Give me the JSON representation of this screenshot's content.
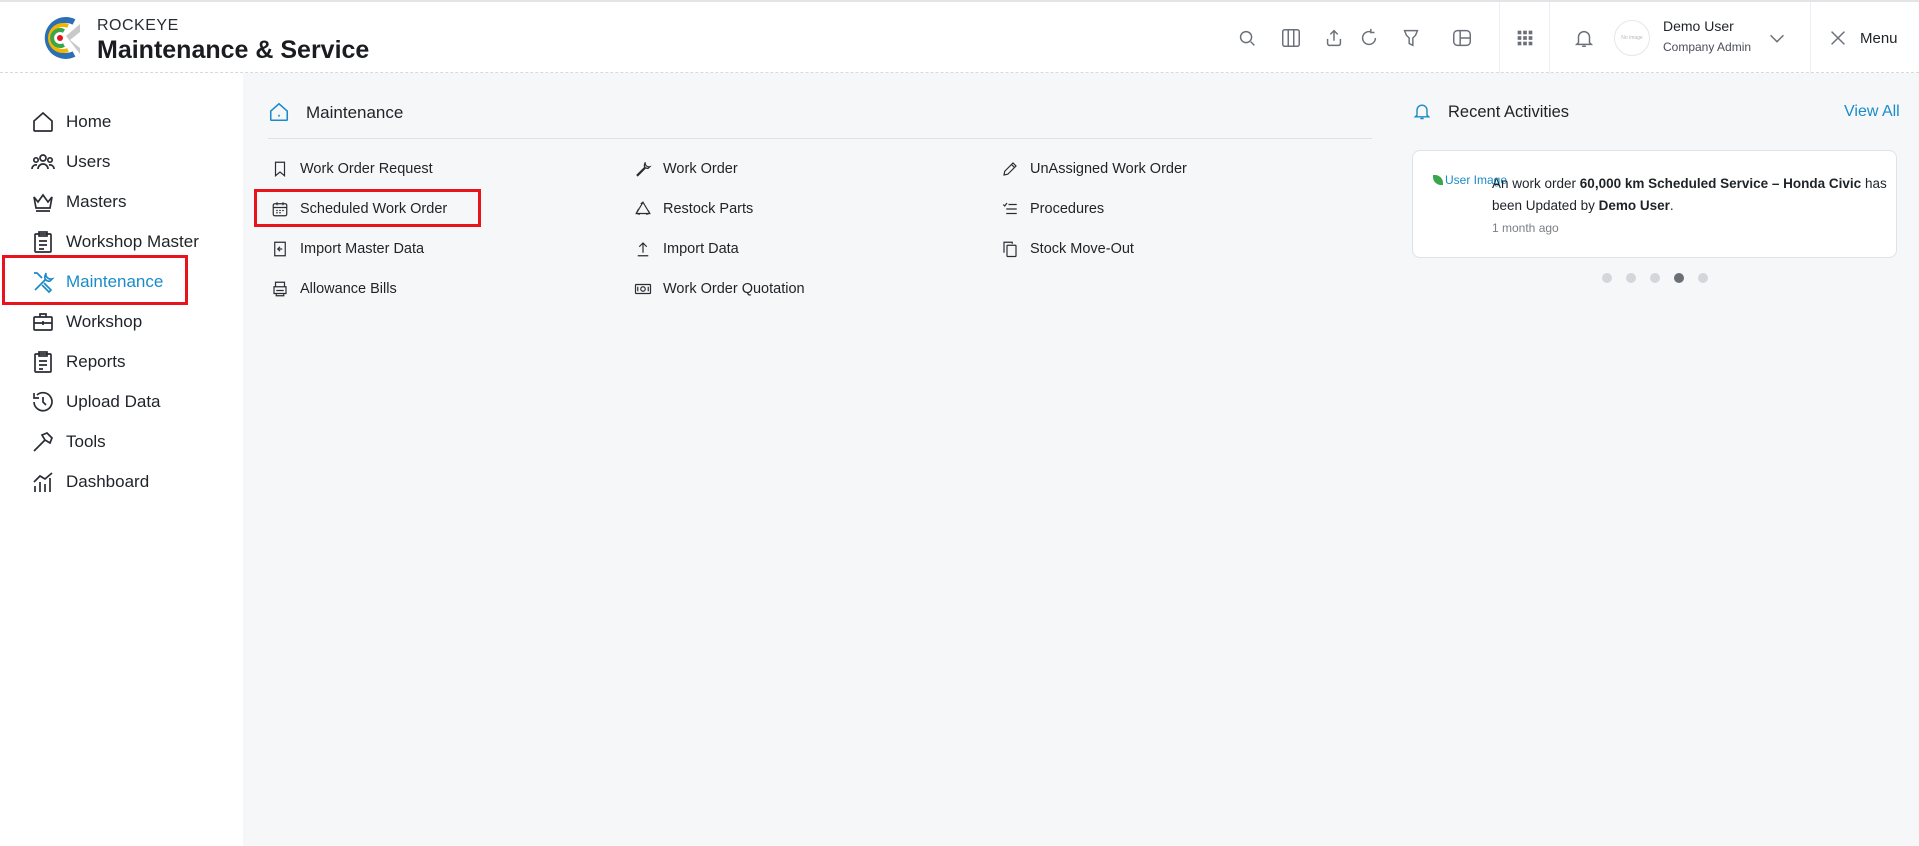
{
  "header": {
    "brand_top": "ROCKEYE",
    "brand_main": "Maintenance & Service",
    "icons": [
      "search-icon",
      "columns-icon",
      "upload-icon",
      "refresh-icon",
      "filter-icon",
      "layout-icon",
      "apps-grid-icon",
      "bell-icon"
    ],
    "avatar_text": "No image",
    "user_name": "Demo User",
    "user_role": "Company Admin",
    "menu_label": "Menu"
  },
  "sidebar": {
    "items": [
      {
        "label": "Home",
        "icon": "home-icon"
      },
      {
        "label": "Users",
        "icon": "users-icon"
      },
      {
        "label": "Masters",
        "icon": "crown-icon"
      },
      {
        "label": "Workshop Master",
        "icon": "clipboard-icon"
      },
      {
        "label": "Maintenance",
        "icon": "tools-icon",
        "active": true
      },
      {
        "label": "Workshop",
        "icon": "briefcase-icon"
      },
      {
        "label": "Reports",
        "icon": "report-icon"
      },
      {
        "label": "Upload Data",
        "icon": "history-icon"
      },
      {
        "label": "Tools",
        "icon": "hammer-icon"
      },
      {
        "label": "Dashboard",
        "icon": "chart-icon"
      }
    ]
  },
  "main": {
    "title": "Maintenance",
    "items": [
      {
        "label": "Work Order Request",
        "icon": "bookmark-icon"
      },
      {
        "label": "Work Order",
        "icon": "wrench-icon"
      },
      {
        "label": "UnAssigned Work Order",
        "icon": "pencil-icon"
      },
      {
        "label": "Scheduled Work Order",
        "icon": "calendar-icon"
      },
      {
        "label": "Restock Parts",
        "icon": "recycle-icon"
      },
      {
        "label": "Procedures",
        "icon": "checklist-icon"
      },
      {
        "label": "Import Master Data",
        "icon": "import-icon"
      },
      {
        "label": "Import Data",
        "icon": "upload-arrow-icon"
      },
      {
        "label": "Stock Move-Out",
        "icon": "copy-icon"
      },
      {
        "label": "Allowance Bills",
        "icon": "printer-icon"
      },
      {
        "label": "Work Order Quotation",
        "icon": "money-icon"
      }
    ]
  },
  "recent": {
    "title": "Recent Activities",
    "view_all": "View All",
    "image_alt": "User Image",
    "text_prefix": "An work order ",
    "text_bold": "60,000 km Scheduled Service – Honda Civic",
    "text_mid": " has been Updated by ",
    "text_user": "Demo User",
    "text_end": ".",
    "time": "1 month ago",
    "dots_total": 5,
    "dots_active": 4
  },
  "colors": {
    "accent": "#1a8bc9",
    "highlight": "#e8141c"
  }
}
